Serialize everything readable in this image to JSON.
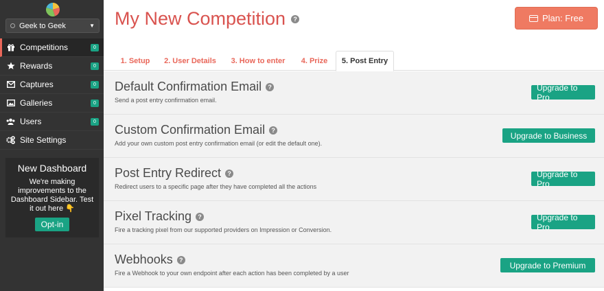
{
  "account": {
    "name": "Geek to Geek"
  },
  "sidebar": {
    "items": [
      {
        "label": "Competitions",
        "icon": "gift-icon",
        "badge": "0",
        "active": true
      },
      {
        "label": "Rewards",
        "icon": "star-icon",
        "badge": "0"
      },
      {
        "label": "Captures",
        "icon": "envelope-icon",
        "badge": "0"
      },
      {
        "label": "Galleries",
        "icon": "image-icon",
        "badge": "0"
      },
      {
        "label": "Users",
        "icon": "users-icon",
        "badge": "0"
      },
      {
        "label": "Site Settings",
        "icon": "gears-icon"
      }
    ],
    "promo": {
      "title": "New Dashboard",
      "text": "We're making improvements to the Dashboard Sidebar. Test it out here 👇",
      "button": "Opt-in"
    }
  },
  "header": {
    "title": "My New Competition",
    "plan_button": "Plan: Free"
  },
  "tabs": [
    {
      "label": "1. Setup"
    },
    {
      "label": "2. User Details"
    },
    {
      "label": "3. How to enter"
    },
    {
      "label": "4. Prize"
    },
    {
      "label": "5. Post Entry",
      "active": true
    }
  ],
  "sections": [
    {
      "title": "Default Confirmation Email",
      "desc": "Send a post entry confirmation email.",
      "button": "Upgrade to Pro"
    },
    {
      "title": "Custom Confirmation Email",
      "desc": "Add your own custom post entry confirmation email (or edit the default one).",
      "button": "Upgrade to Business"
    },
    {
      "title": "Post Entry Redirect",
      "desc": "Redirect users to a specific page after they have completed all the actions",
      "button": "Upgrade to Pro"
    },
    {
      "title": "Pixel Tracking",
      "desc": "Fire a tracking pixel from our supported providers on Impression or Conversion.",
      "button": "Upgrade to Pro"
    },
    {
      "title": "Webhooks",
      "desc": "Fire a Webhook to your own endpoint after each action has been completed by a user",
      "button": "Upgrade to Premium"
    }
  ],
  "colors": {
    "accent": "#e9675a",
    "title": "#d9534f",
    "plan_button": "#ef7a62",
    "upgrade_button": "#1aa384",
    "sidebar": "#333333"
  }
}
